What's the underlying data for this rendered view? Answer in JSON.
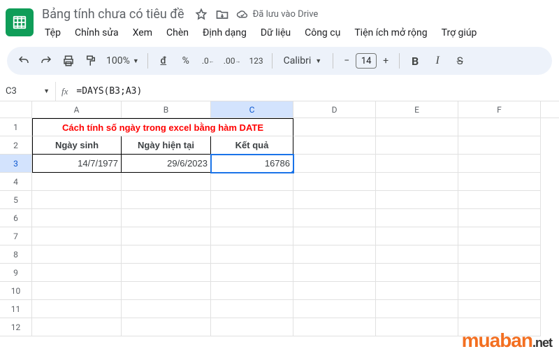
{
  "doc": {
    "title": "Bảng tính chưa có tiêu đề",
    "drive_status": "Đã lưu vào Drive"
  },
  "menu": {
    "file": "Tệp",
    "edit": "Chỉnh sửa",
    "view": "Xem",
    "insert": "Chèn",
    "format": "Định dạng",
    "data": "Dữ liệu",
    "tools": "Công cụ",
    "extensions": "Tiện ích mở rộng",
    "help": "Trợ giúp"
  },
  "toolbar": {
    "zoom": "100%",
    "currency": "đ",
    "percent": "%",
    "dec_dec": ".0",
    "inc_dec": ".00",
    "numfmt": "123",
    "font": "Calibri",
    "font_size": "14",
    "bold": "B",
    "italic": "I",
    "strike": "S"
  },
  "namebox": "C3",
  "formula": "=DAYS(B3;A3)",
  "columns": [
    "A",
    "B",
    "C",
    "D",
    "E",
    "F"
  ],
  "rows": [
    "1",
    "2",
    "3",
    "4",
    "5",
    "6",
    "7",
    "8",
    "9",
    "10",
    "11",
    "12"
  ],
  "content": {
    "title_row": "Cách tính số ngày trong excel bằng hàm DATE",
    "header": {
      "a": "Ngày sinh",
      "b": "Ngày hiện tại",
      "c": "Kết quả"
    },
    "data": {
      "a": "14/7/1977",
      "b": "29/6/2023",
      "c": "16786"
    }
  },
  "chart_data": {
    "type": "table",
    "title": "Cách tính số ngày trong excel bằng hàm DATE",
    "columns": [
      "Ngày sinh",
      "Ngày hiện tại",
      "Kết quả"
    ],
    "rows": [
      [
        "14/7/1977",
        "29/6/2023",
        16786
      ]
    ]
  },
  "watermark": {
    "part1": "muaban",
    "part2": ".net"
  }
}
